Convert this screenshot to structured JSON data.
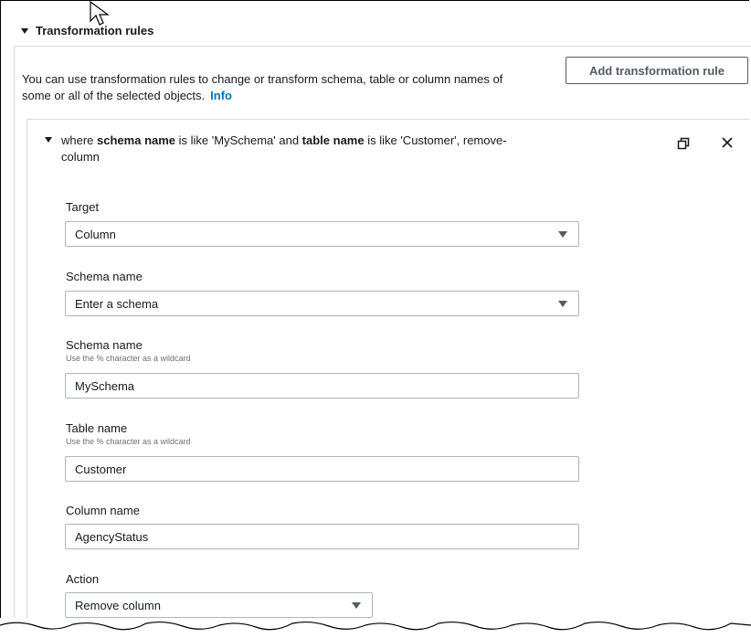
{
  "section": {
    "title": "Transformation rules",
    "description": "You can use transformation rules to change or transform schema, table or column names of some or all of the selected objects.",
    "info_link": "Info",
    "add_button": "Add transformation rule"
  },
  "rule": {
    "summary_prefix": "where ",
    "summary_key1": "schema name",
    "summary_mid1": " is like 'MySchema' and ",
    "summary_key2": "table name",
    "summary_suffix": " is like 'Customer', remove-column"
  },
  "fields": {
    "target": {
      "label": "Target",
      "value": "Column"
    },
    "schema_select": {
      "label": "Schema name",
      "value": "Enter a schema"
    },
    "schema_input": {
      "label": "Schema name",
      "hint": "Use the % character as a wildcard",
      "value": "MySchema"
    },
    "table_input": {
      "label": "Table name",
      "hint": "Use the % character as a wildcard",
      "value": "Customer"
    },
    "column_input": {
      "label": "Column name",
      "value": "AgencyStatus"
    },
    "action": {
      "label": "Action",
      "value": "Remove column"
    }
  },
  "icons": {
    "copy": "copy-icon",
    "close": "close-icon",
    "pointer": "mouse-pointer-icon"
  },
  "colors": {
    "link": "#0073bb",
    "border": "#aab7b8",
    "text": "#16191f"
  }
}
